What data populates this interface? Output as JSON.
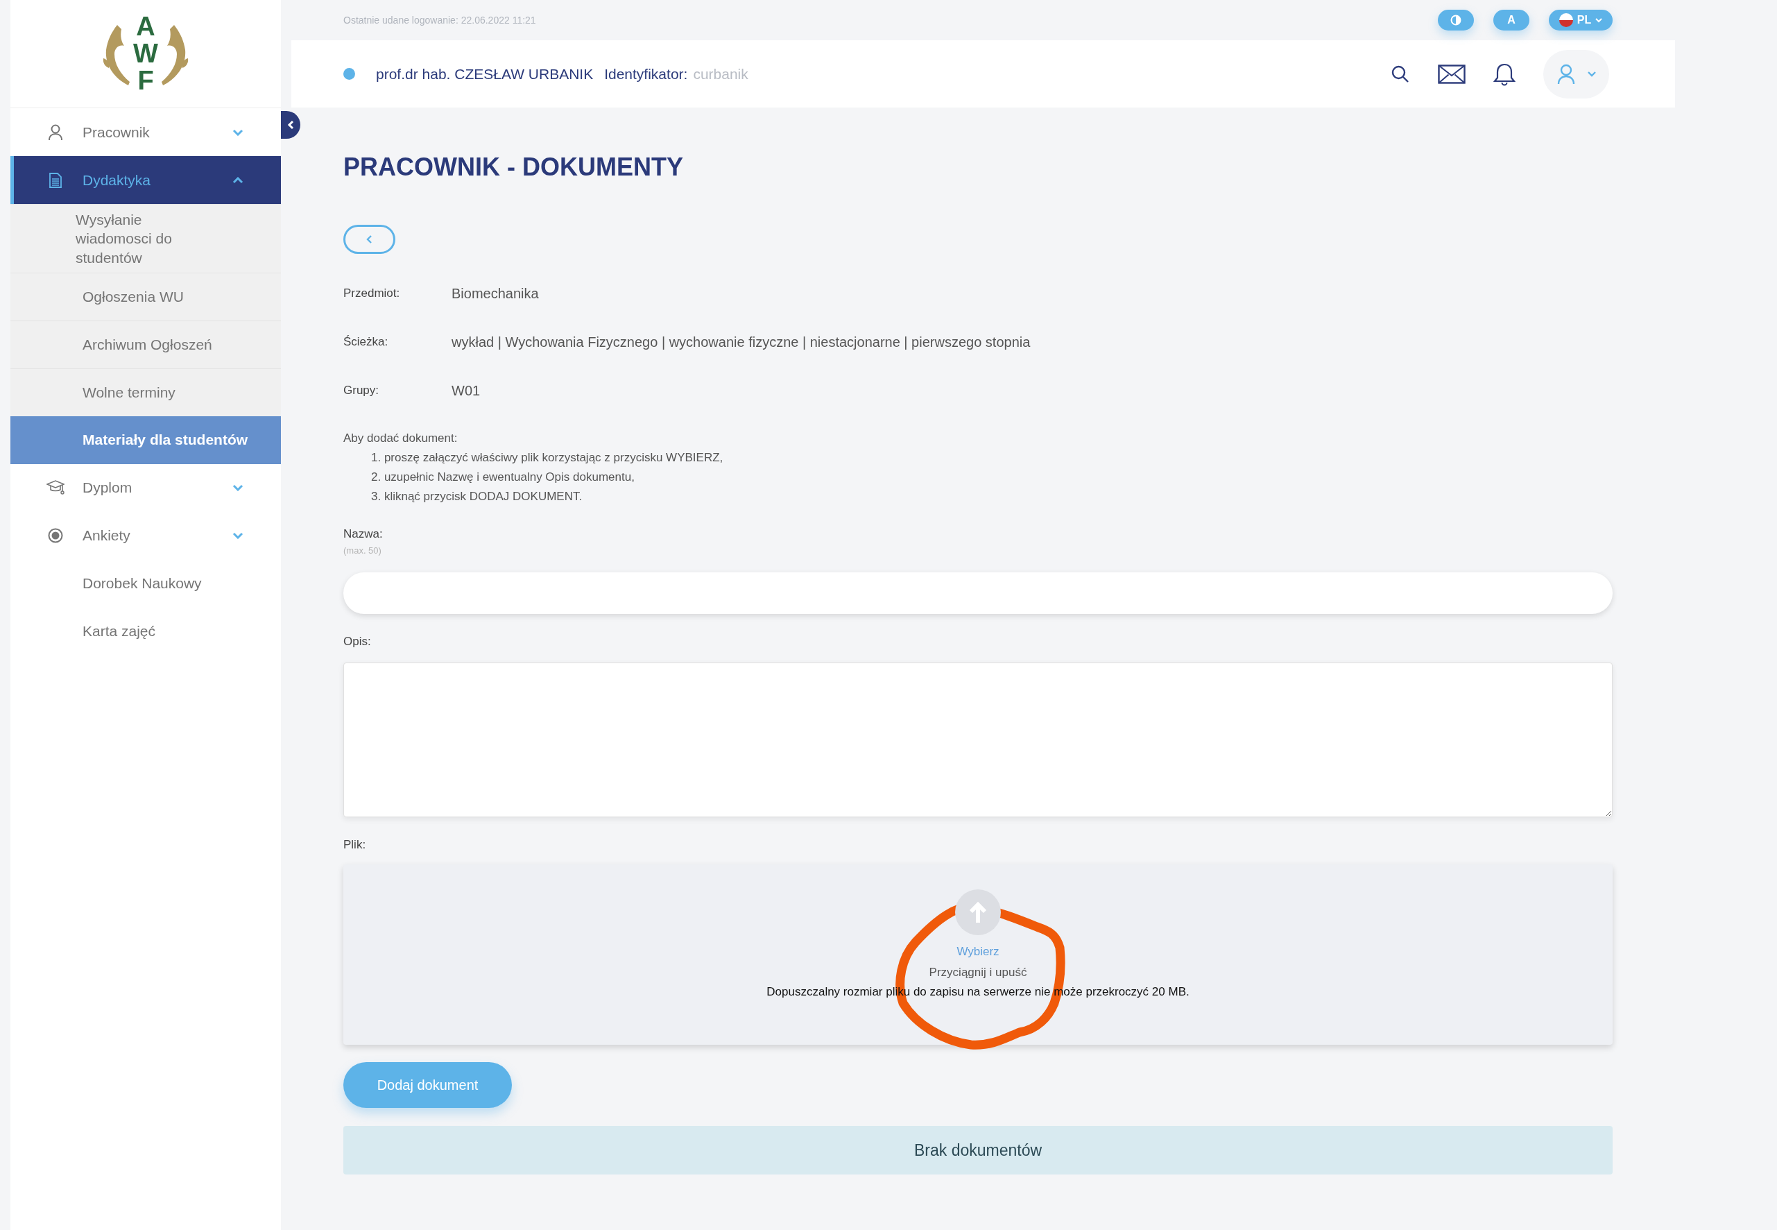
{
  "logo": {
    "text": "AWF"
  },
  "sidebar": {
    "items": [
      {
        "label": "Pracownik",
        "expanded": false,
        "selected": false
      },
      {
        "label": "Dydaktyka",
        "expanded": true,
        "selected": true,
        "children": [
          {
            "label": "Wysyłanie wiadomosci do studentów",
            "selected": false
          },
          {
            "label": "Ogłoszenia WU",
            "selected": false
          },
          {
            "label": "Archiwum Ogłoszeń",
            "selected": false
          },
          {
            "label": "Wolne terminy",
            "selected": false
          },
          {
            "label": "Materiały dla studentów",
            "selected": true
          }
        ]
      },
      {
        "label": "Dyplom",
        "expanded": false,
        "selected": false
      },
      {
        "label": "Ankiety",
        "expanded": false,
        "selected": false
      },
      {
        "label": "Dorobek Naukowy",
        "selected": false
      },
      {
        "label": "Karta zajęć",
        "selected": false
      }
    ]
  },
  "top_bar": {
    "last_login": "Ostatnie udane logowanie: 22.06.2022 11:21",
    "font_button": "A",
    "language": "PL"
  },
  "header": {
    "user_name": "prof.dr hab. CZESŁAW URBANIK",
    "id_label": "Identyfikator:",
    "id_value": "curbanik"
  },
  "page": {
    "title": "PRACOWNIK - DOKUMENTY",
    "details": [
      {
        "label": "Przedmiot:",
        "value": "Biomechanika"
      },
      {
        "label": "Ścieżka:",
        "value": "wykład | Wychowania Fizycznego | wychowanie fizyczne | niestacjonarne | pierwszego stopnia"
      },
      {
        "label": "Grupy:",
        "value": "W01"
      }
    ],
    "instructions": {
      "intro": "Aby dodać dokument:",
      "steps": [
        "1. proszę załączyć właściwy plik korzystając z przycisku WYBIERZ,",
        "2. uzupełnic Nazwę i ewentualny Opis dokumentu,",
        "3. kliknąć przycisk DODAJ DOKUMENT."
      ]
    },
    "fields": [
      {
        "kind": "input",
        "label": "Nazwa:",
        "hint": "(max. 50)"
      },
      {
        "kind": "textarea",
        "label": "Opis:"
      }
    ],
    "upload": {
      "label": "Plik:",
      "choose": "Wybierz",
      "drag": "Przyciągnij i upuść",
      "limit": "Dopuszczalny rozmiar pliku do zapisu na serwerze nie może przekroczyć 20 MB."
    },
    "annotation": {
      "kind": "circle"
    },
    "submit": "Dodaj dokument",
    "empty_message": "Brak dokumentów"
  }
}
